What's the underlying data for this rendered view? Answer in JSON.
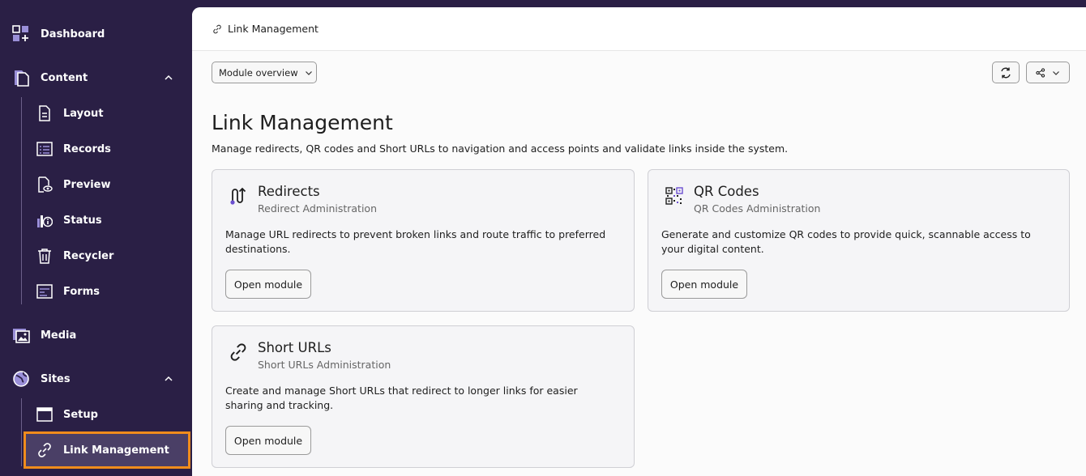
{
  "sidebar": {
    "dashboard": "Dashboard",
    "content": "Content",
    "content_items": [
      "Layout",
      "Records",
      "Preview",
      "Status",
      "Recycler",
      "Forms"
    ],
    "media": "Media",
    "sites": "Sites",
    "sites_items": [
      "Setup",
      "Link Management"
    ]
  },
  "topbar": {
    "breadcrumb": "Link Management"
  },
  "toolbar": {
    "module_select": "Module overview"
  },
  "page": {
    "title": "Link Management",
    "description": "Manage redirects, QR codes and Short URLs to navigation and access points and validate links inside the system."
  },
  "cards": [
    {
      "title": "Redirects",
      "subtitle": "Redirect Administration",
      "description": "Manage URL redirects to prevent broken links and route traffic to preferred destinations.",
      "button": "Open module"
    },
    {
      "title": "QR Codes",
      "subtitle": "QR Codes Administration",
      "description": "Generate and customize QR codes to provide quick, scannable access to your digital content.",
      "button": "Open module"
    },
    {
      "title": "Short URLs",
      "subtitle": "Short URLs Administration",
      "description": "Create and manage Short URLs that redirect to longer links for easier sharing and tracking.",
      "button": "Open module"
    }
  ],
  "colors": {
    "sidebar_bg": "#2a1f45",
    "active_highlight": "#f08c1c",
    "accent_purple": "#6b4fd0"
  }
}
